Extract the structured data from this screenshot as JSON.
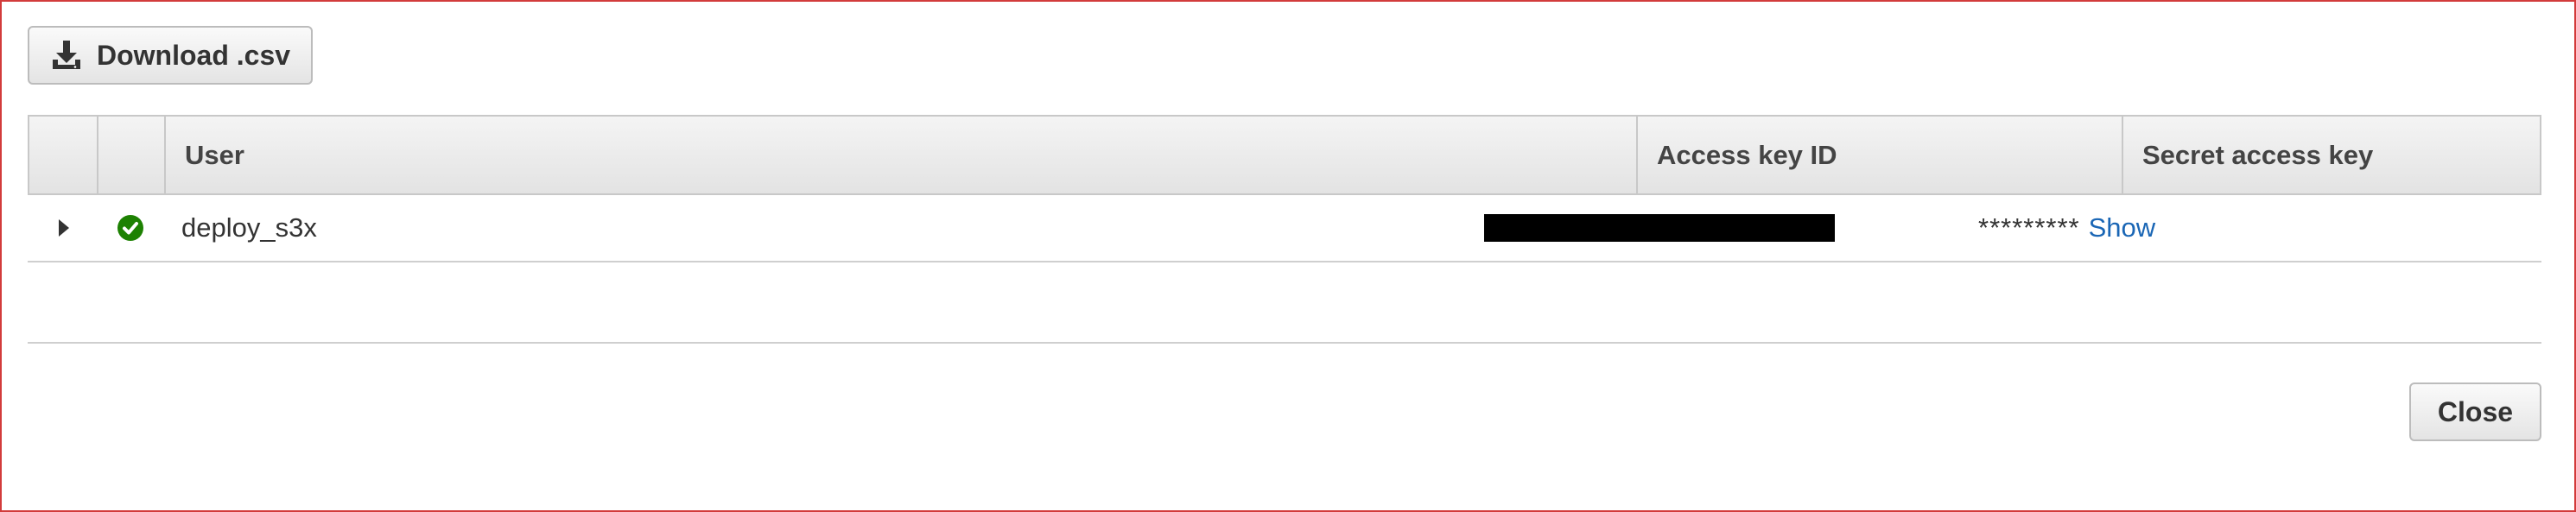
{
  "toolbar": {
    "download_label": "Download .csv",
    "download_icon": "download-icon"
  },
  "table": {
    "columns": [
      "",
      "",
      "User",
      "Access key ID",
      "Secret access key"
    ],
    "rows": [
      {
        "status_icon": "check-circle-icon",
        "status_color": "#1d8102",
        "user": "deploy_s3x",
        "access_key_id": "",
        "secret_masked": "*********",
        "secret_action": "Show"
      }
    ]
  },
  "footer": {
    "close_label": "Close"
  },
  "colors": {
    "border_accent": "#d23b3b",
    "link": "#1a66b5"
  }
}
